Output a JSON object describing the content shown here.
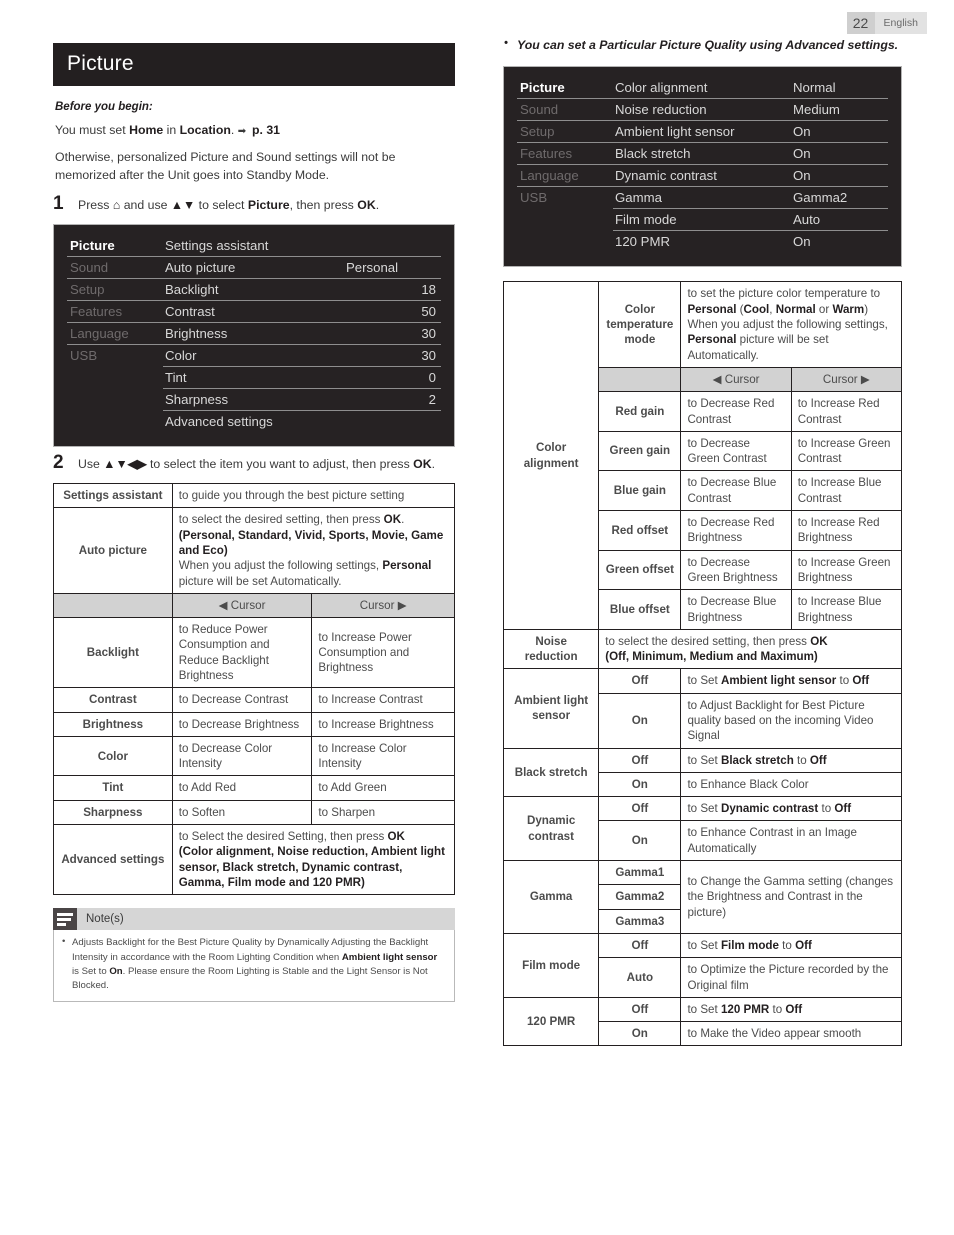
{
  "header": {
    "page_number": "22",
    "language": "English"
  },
  "left": {
    "title": "Picture",
    "before_label": "Before you begin:",
    "para1_pre": "You must set ",
    "para1_home": "Home",
    "para1_mid": " in ",
    "para1_loc": "Location",
    "para1_dot": ". ",
    "para1_arrow": "➡",
    "para1_page": "p. 31",
    "para2": "Otherwise, personalized Picture and Sound settings will not be memorized after the Unit goes into Standby Mode.",
    "step1_num": "1",
    "step1_pre": "Press ",
    "step1_home_icon": "⌂",
    "step1_mid": " and use ",
    "step1_updown": "▲▼",
    "step1_mid2": " to select ",
    "step1_bold": "Picture",
    "step1_post": ", then press ",
    "step1_ok": "OK",
    "step1_end": ".",
    "step2_num": "2",
    "step2_pre": "Use ",
    "step2_keys": "▲▼◀▶",
    "step2_post": " to select the item you want to adjust, then press ",
    "step2_ok": "OK",
    "step2_end": ".",
    "osd": {
      "nav": [
        "Picture",
        "Sound",
        "Setup",
        "Features",
        "Language",
        "USB"
      ],
      "active_nav": "Picture",
      "items": [
        {
          "label": "Settings assistant",
          "value": ""
        },
        {
          "label": "Auto picture",
          "value": "Personal",
          "numeric": false
        },
        {
          "label": "Backlight",
          "value": "18",
          "numeric": true
        },
        {
          "label": "Contrast",
          "value": "50",
          "numeric": true
        },
        {
          "label": "Brightness",
          "value": "30",
          "numeric": true
        },
        {
          "label": "Color",
          "value": "30",
          "numeric": true
        },
        {
          "label": "Tint",
          "value": "0",
          "numeric": true
        },
        {
          "label": "Sharpness",
          "value": "2",
          "numeric": true
        },
        {
          "label": "Advanced settings",
          "value": "",
          "last": true
        }
      ]
    },
    "table": {
      "settings_assistant_key": "Settings assistant",
      "settings_assistant_desc": "to guide you through the best picture setting",
      "auto_picture_key": "Auto picture",
      "auto_picture_l1_pre": "to select the desired setting, then press ",
      "auto_picture_l1_ok": "OK",
      "auto_picture_l1_end": ".",
      "auto_picture_l2": "(Personal, Standard, Vivid, Sports, Movie, Game and Eco)",
      "auto_picture_l3_pre": "When you adjust the following settings, ",
      "auto_picture_l3_bold": "Personal",
      "auto_picture_l3_end": " picture will be set Automatically.",
      "cursor_left": "◀ Cursor",
      "cursor_right": "Cursor ▶",
      "rows": [
        {
          "key": "Backlight",
          "left": "to Reduce Power Consumption and Reduce Backlight Brightness",
          "right": "to Increase Power Consumption and Brightness"
        },
        {
          "key": "Contrast",
          "left": "to Decrease Contrast",
          "right": "to Increase Contrast"
        },
        {
          "key": "Brightness",
          "left": "to Decrease Brightness",
          "right": "to Increase Brightness"
        },
        {
          "key": "Color",
          "left": "to Decrease Color Intensity",
          "right": "to Increase Color Intensity"
        },
        {
          "key": "Tint",
          "left": "to Add Red",
          "right": "to Add Green"
        },
        {
          "key": "Sharpness",
          "left": "to Soften",
          "right": "to Sharpen"
        }
      ],
      "advanced_key": "Advanced settings",
      "advanced_l1_pre": "to Select the desired Setting, then press ",
      "advanced_l1_ok": "OK",
      "advanced_l2": "(Color alignment, Noise reduction, Ambient light sensor, Black stretch, Dynamic contrast, Gamma, Film mode and 120 PMR)"
    },
    "notes": {
      "title": "Note(s)",
      "items": [
        {
          "pre": "Adjusts Backlight for the Best Picture Quality by Dynamically Adjusting the Backlight Intensity in accordance with the Room Lighting Condition when ",
          "bold1": "Ambient light sensor",
          "mid": " is Set to ",
          "bold2": "On",
          "post": ". Please ensure the Room Lighting is Stable and the Light Sensor is Not Blocked."
        }
      ]
    }
  },
  "right": {
    "lead": "You can set a Particular Picture Quality using Advanced settings.",
    "osd": {
      "nav": [
        "Picture",
        "Sound",
        "Setup",
        "Features",
        "Language",
        "USB"
      ],
      "active_nav": "Picture",
      "items": [
        {
          "label": "Color alignment",
          "value": "Normal"
        },
        {
          "label": "Noise reduction",
          "value": "Medium"
        },
        {
          "label": "Ambient light sensor",
          "value": "On"
        },
        {
          "label": "Black stretch",
          "value": "On"
        },
        {
          "label": "Dynamic contrast",
          "value": "On"
        },
        {
          "label": "Gamma",
          "value": "Gamma2"
        },
        {
          "label": "Film mode",
          "value": "Auto"
        },
        {
          "label": "120 PMR",
          "value": "On",
          "last": true
        }
      ]
    },
    "table": {
      "color_alignment_key": "Color alignment",
      "ctm_key": "Color temperature mode",
      "ctm_l1": "to set the picture color temperature to",
      "ctm_l2_bold": "Personal",
      "ctm_l2_open": " (",
      "ctm_cool": "Cool",
      "ctm_c1": ", ",
      "ctm_normal": "Normal",
      "ctm_or": " or ",
      "ctm_warm": "Warm",
      "ctm_close": ")",
      "ctm_l3_pre": "When you adjust the following settings, ",
      "ctm_l3_bold": "Personal",
      "ctm_l3_end": " picture will be set Automatically.",
      "cursor_left": "◀ Cursor",
      "cursor_right": "Cursor ▶",
      "gain_rows": [
        {
          "key": "Red gain",
          "left": "to Decrease Red Contrast",
          "right": "to Increase Red Contrast"
        },
        {
          "key": "Green gain",
          "left": "to Decrease Green Contrast",
          "right": "to Increase Green Contrast"
        },
        {
          "key": "Blue gain",
          "left": "to Decrease Blue Contrast",
          "right": "to Increase Blue Contrast"
        },
        {
          "key": "Red offset",
          "left": "to Decrease Red Brightness",
          "right": "to Increase Red Brightness"
        },
        {
          "key": "Green offset",
          "left": "to Decrease Green Brightness",
          "right": "to Increase Green Brightness"
        },
        {
          "key": "Blue offset",
          "left": "to Decrease Blue Brightness",
          "right": "to Increase Blue Brightness"
        }
      ],
      "noise_key": "Noise reduction",
      "noise_l1_pre": "to select the desired setting, then press ",
      "noise_l1_ok": "OK",
      "noise_l2": "(Off, Minimum, Medium and Maximum)",
      "als_key": "Ambient light sensor",
      "als_off_val": "Off",
      "als_off_pre": "to Set ",
      "als_off_bold": "Ambient light sensor",
      "als_off_mid": " to ",
      "als_off_bold2": "Off",
      "als_on_val": "On",
      "als_on_desc": "to Adjust Backlight for Best Picture quality based on the incoming Video Signal",
      "bs_key": "Black stretch",
      "bs_off_val": "Off",
      "bs_off_pre": "to Set ",
      "bs_off_bold": "Black stretch",
      "bs_off_mid": " to ",
      "bs_off_bold2": "Off",
      "bs_on_val": "On",
      "bs_on_desc": "to Enhance Black Color",
      "dc_key": "Dynamic contrast",
      "dc_off_val": "Off",
      "dc_off_pre": "to Set ",
      "dc_off_bold": "Dynamic contrast",
      "dc_off_mid": " to ",
      "dc_off_bold2": "Off",
      "dc_on_val": "On",
      "dc_on_desc": "to Enhance Contrast in an Image Automatically",
      "gamma_key": "Gamma",
      "gamma_opts": [
        "Gamma1",
        "Gamma2",
        "Gamma3"
      ],
      "gamma_desc": "to Change the Gamma setting (changes the Brightness and Contrast in the picture)",
      "fm_key": "Film mode",
      "fm_off_val": "Off",
      "fm_off_pre": "to Set ",
      "fm_off_bold": "Film mode",
      "fm_off_mid": " to ",
      "fm_off_bold2": "Off",
      "fm_auto_val": "Auto",
      "fm_auto_desc": "to Optimize the Picture recorded by the Original film",
      "pmr_key": "120 PMR",
      "pmr_off_val": "Off",
      "pmr_off_pre": "to Set ",
      "pmr_off_bold": "120 PMR",
      "pmr_off_mid": " to ",
      "pmr_off_bold2": "Off",
      "pmr_on_val": "On",
      "pmr_on_desc": "to Make the Video appear smooth"
    }
  }
}
